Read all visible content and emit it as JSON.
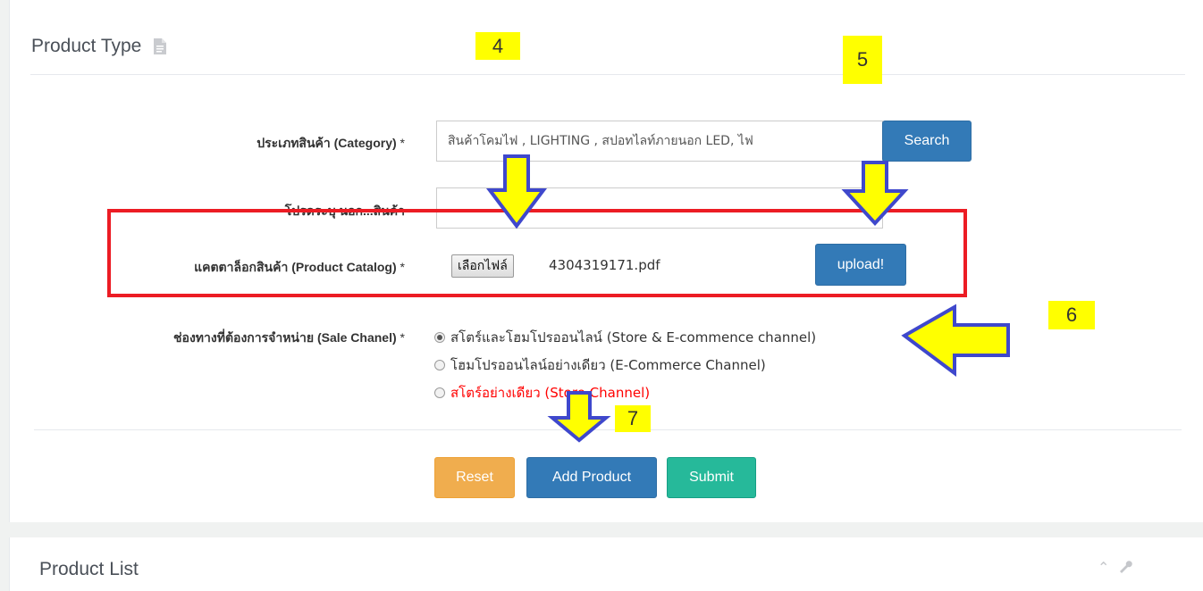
{
  "product_type_panel": {
    "title": "Product Type",
    "title_icon": "document-icon"
  },
  "form": {
    "category": {
      "label": "ประเภทสินค้า (Category)",
      "required": "*",
      "value": "สินค้าโคมไฟ , LIGHTING , สปอทไลท์ภายนอก LED, ไฟ",
      "search_label": "Search"
    },
    "other_category": {
      "label": "โปรดระบุ นอก...สินค้า",
      "value": ""
    },
    "catalog": {
      "label": "แคตตาล็อกสินค้า (Product Catalog)",
      "required": "*",
      "choose_file_label": "เลือกไฟล์",
      "file_name": "4304319171.pdf",
      "upload_label": "upload!"
    },
    "sale_channel": {
      "label": "ช่องทางที่ต้องการจำหน่าย (Sale Chanel)",
      "required": "*",
      "options": [
        {
          "label": "สโตร์และโฮมโปรออนไลน์ (Store & E-commence channel)",
          "selected": true
        },
        {
          "label": "โฮมโปรออนไลน์อย่างเดียว (E-Commerce Channel)",
          "selected": false
        },
        {
          "label": "สโตร์อย่างเดียว (Store Channel)",
          "selected": false
        }
      ]
    },
    "buttons": {
      "reset": "Reset",
      "add_product": "Add Product",
      "submit": "Submit"
    }
  },
  "annotations": {
    "markers": [
      "4",
      "5",
      "6",
      "7"
    ],
    "highlight_color": "#ec1c24",
    "arrow_fill": "#ffff00",
    "arrow_stroke": "#3f48cc"
  },
  "product_list_panel": {
    "title": "Product List",
    "tools": [
      "chevron-up-icon",
      "wrench-icon"
    ]
  }
}
